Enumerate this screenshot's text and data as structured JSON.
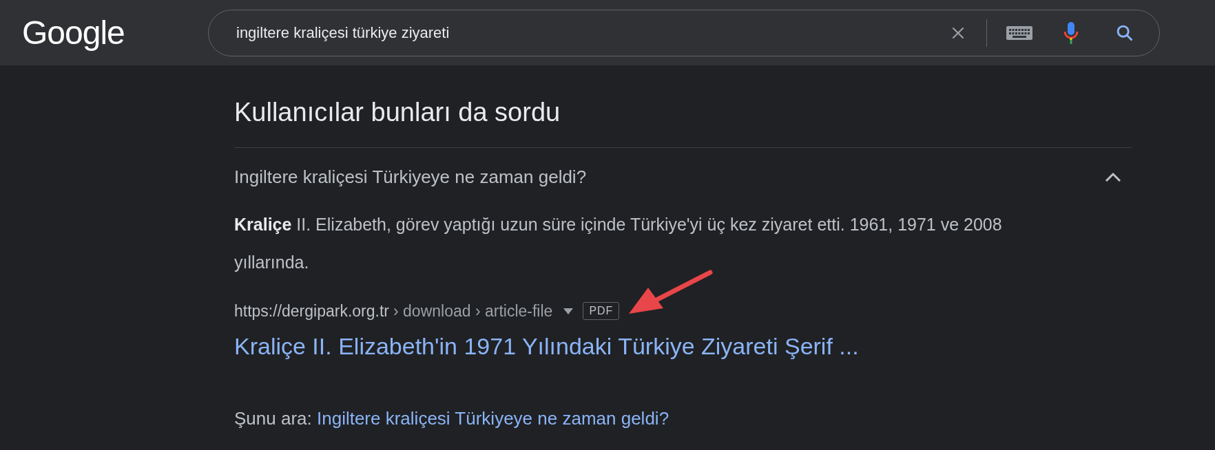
{
  "header": {
    "logo": "Google",
    "search": {
      "value": "ingiltere kraliçesi türkiye ziyareti"
    }
  },
  "section": {
    "title": "Kullanıcılar bunları da sordu",
    "questions": [
      {
        "question": "Ingiltere kraliçesi Türkiyeye ne zaman geldi?",
        "expanded": true,
        "answer": "**Kraliçe** II. Elizabeth, görev yaptığı uzun süre içinde Türkiye'yi üç kez ziyaret etti. 1961, 1971 ve 2008 yıllarında.",
        "source": {
          "domain": "https://dergipark.org.tr",
          "path": "› download › article-file",
          "badge": "PDF",
          "title": "Kraliçe II. Elizabeth'in 1971 Yılındaki Türkiye Ziyareti Şerif ..."
        },
        "search_prompt": "Şunu ara:",
        "search_link": "Ingiltere kraliçesi Türkiyeye ne zaman geldi?"
      }
    ]
  }
}
